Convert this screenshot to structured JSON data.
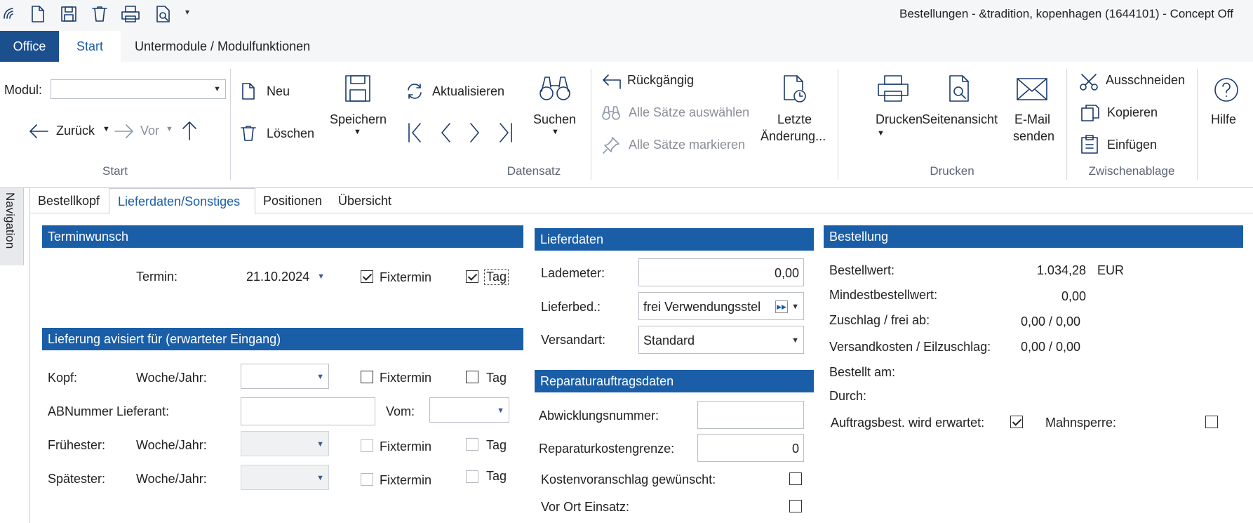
{
  "window": {
    "title": "Bestellungen - &tradition, kopenhagen (1644101) - Concept Off"
  },
  "ribbon_tabs": [
    {
      "label": "Office"
    },
    {
      "label": "Start"
    },
    {
      "label": "Untermodule / Modulfunktionen"
    }
  ],
  "start_group": {
    "modul_label": "Modul:",
    "modul_value": "",
    "back_label": "Zurück",
    "forward_label": "Vor",
    "group_label": "Start"
  },
  "datensatz": {
    "new": "Neu",
    "delete": "Löschen",
    "save": "Speichern",
    "refresh": "Aktualisieren",
    "search": "Suchen",
    "undo": "Rückgängig",
    "select_all": "Alle Sätze auswählen",
    "mark_all": "Alle Sätze markieren",
    "last_change_1": "Letzte",
    "last_change_2": "Änderung...",
    "group_label": "Datensatz"
  },
  "drucken": {
    "print": "Drucken",
    "preview": "Seitenansicht",
    "email_1": "E-Mail",
    "email_2": "senden",
    "group_label": "Drucken"
  },
  "clipboard": {
    "cut": "Ausschneiden",
    "copy": "Kopieren",
    "paste": "Einfügen",
    "group_label": "Zwischenablage"
  },
  "help": {
    "label": "Hilfe"
  },
  "navigation": {
    "label": "Navigation"
  },
  "doc_tabs": [
    {
      "label": "Bestellkopf"
    },
    {
      "label": "Lieferdaten/Sonstiges"
    },
    {
      "label": "Positionen"
    },
    {
      "label": "Übersicht"
    }
  ],
  "terminwunsch": {
    "header": "Terminwunsch",
    "termin_label": "Termin:",
    "termin_value": "21.10.2024",
    "fixtermin_label": "Fixtermin",
    "fixtermin_checked": true,
    "tag_label": "Tag",
    "tag_checked": true
  },
  "lieferung": {
    "header": "Lieferung avisiert für (erwarteter Eingang)",
    "kopf_label": "Kopf:",
    "week_label": "Woche/Jahr:",
    "fixtermin_label": "Fixtermin",
    "tag_label": "Tag",
    "ab_label": "ABNummer Lieferant:",
    "vom_label": "Vom:",
    "fruehester_label": "Frühester:",
    "spaetester_label": "Spätester:"
  },
  "lieferdaten": {
    "header": "Lieferdaten",
    "lademeter_label": "Lademeter:",
    "lademeter_value": "0,00",
    "lieferbed_label": "Lieferbed.:",
    "lieferbed_value": "frei Verwendungsstel",
    "versandart_label": "Versandart:",
    "versandart_value": "Standard"
  },
  "reparatur": {
    "header": "Reparaturauftragsdaten",
    "abwicklung_label": "Abwicklungsnummer:",
    "abwicklung_value": "",
    "grenze_label": "Reparaturkostengrenze:",
    "grenze_value": "0",
    "kva_label": "Kostenvoranschlag gewünscht:",
    "kva_checked": false,
    "vorort_label": "Vor Ort Einsatz:",
    "vorort_checked": false
  },
  "bestellung": {
    "header": "Bestellung",
    "bestellwert_label": "Bestellwert:",
    "bestellwert_value": "1.034,28",
    "currency": "EUR",
    "mindest_label": "Mindestbestellwert:",
    "mindest_value": "0,00",
    "zuschlag_label": "Zuschlag / frei ab:",
    "zuschlag_value": "0,00 / 0,00",
    "versandkosten_label": "Versandkosten / Eilzuschlag:",
    "versandkosten_value": "0,00 / 0,00",
    "bestellt_label": "Bestellt am:",
    "durch_label": "Durch:",
    "auftragsbest_label": "Auftragsbest. wird erwartet:",
    "auftragsbest_checked": true,
    "mahnsperre_label": "Mahnsperre:",
    "mahnsperre_checked": false
  },
  "colors": {
    "accent": "#1a5ea8",
    "office_tab": "#1b4f8e",
    "ribbon_bg": "#f5f6f8"
  }
}
